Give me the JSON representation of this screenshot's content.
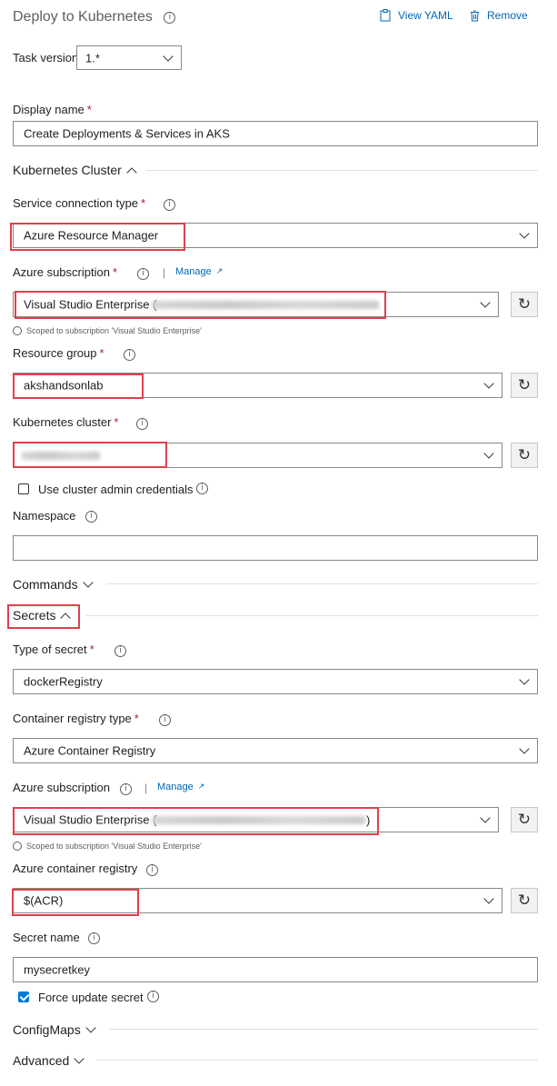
{
  "header": {
    "title": "Deploy to Kubernetes",
    "view_yaml": "View YAML",
    "remove": "Remove",
    "info_glyph": "i"
  },
  "task_version": {
    "label": "Task version",
    "value": "1.*"
  },
  "display_name": {
    "label": "Display name",
    "required": "*",
    "value": "Create Deployments & Services in AKS"
  },
  "sections": {
    "kubernetes_cluster": "Kubernetes Cluster",
    "commands": "Commands",
    "secrets": "Secrets",
    "configmaps": "ConfigMaps",
    "advanced": "Advanced"
  },
  "cluster": {
    "service_connection_type": {
      "label": "Service connection type",
      "required": "*",
      "value": "Azure Resource Manager"
    },
    "azure_subscription": {
      "label": "Azure subscription",
      "required": "*",
      "manage": "Manage",
      "separator": "|",
      "value": "Visual Studio Enterprise (",
      "hint": "Scoped to subscription 'Visual Studio Enterprise'"
    },
    "resource_group": {
      "label": "Resource group",
      "required": "*",
      "value": "akshandsonlab"
    },
    "kubernetes_cluster": {
      "label": "Kubernetes cluster",
      "required": "*",
      "value": ""
    },
    "use_admin": {
      "label": "Use cluster admin credentials",
      "checked": false
    },
    "namespace": {
      "label": "Namespace",
      "value": ""
    }
  },
  "secrets": {
    "type_of_secret": {
      "label": "Type of secret",
      "required": "*",
      "value": "dockerRegistry"
    },
    "container_registry_type": {
      "label": "Container registry type",
      "required": "*",
      "value": "Azure Container Registry"
    },
    "azure_subscription": {
      "label": "Azure subscription",
      "manage": "Manage",
      "separator": "|",
      "value": "Visual Studio Enterprise (",
      "value_end": ")",
      "hint": "Scoped to subscription 'Visual Studio Enterprise'"
    },
    "azure_container_registry": {
      "label": "Azure container registry",
      "value": "$(ACR)"
    },
    "secret_name": {
      "label": "Secret name",
      "value": "mysecretkey"
    },
    "force_update": {
      "label": "Force update secret",
      "checked": true
    }
  },
  "colors": {
    "highlight": "#e0404b",
    "link": "#0067b8",
    "checkbox_on": "#0078d4"
  }
}
